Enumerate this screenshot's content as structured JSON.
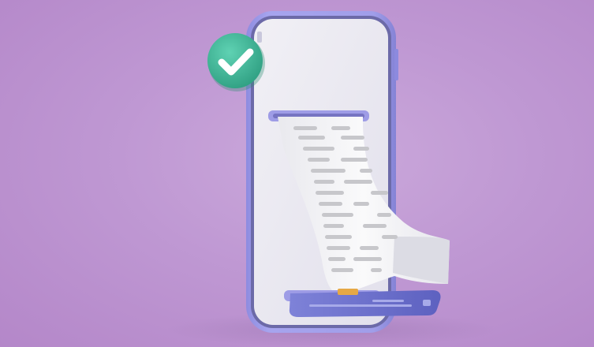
{
  "scene": {
    "description_free": true,
    "colors": {
      "background": "#c6a2d8",
      "phone_frame": "#9c9ae8",
      "phone_screen": "#eceaf3",
      "receipt": "#f4f4f6",
      "receipt_lines": "#c7c7cb",
      "checkmark_badge": "#41b89a",
      "card": "#6f73cf"
    },
    "icons": {
      "badge": "checkmark-icon"
    }
  }
}
